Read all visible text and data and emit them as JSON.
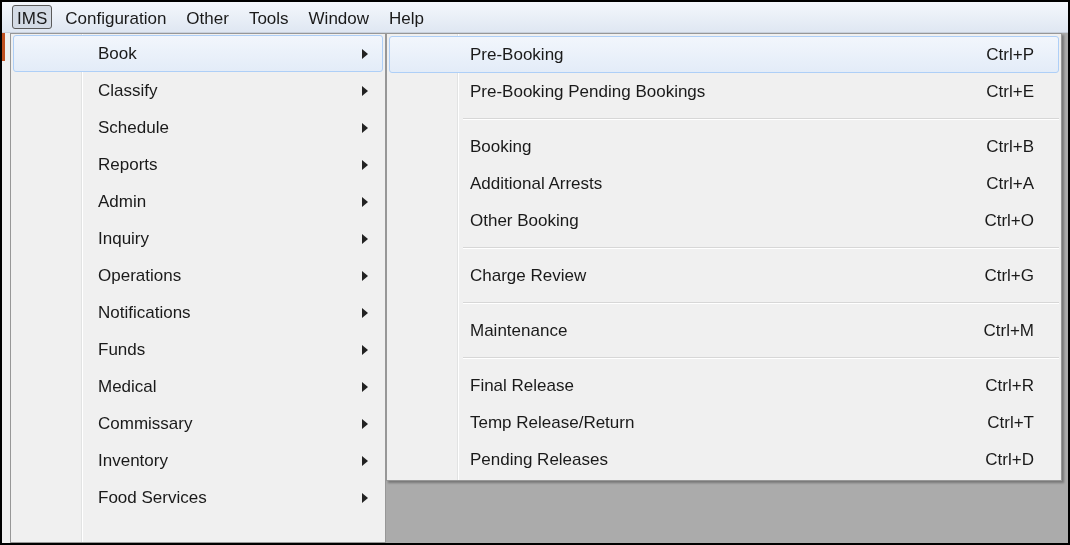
{
  "menubar": [
    {
      "label": "IMS",
      "selected": true
    },
    {
      "label": "Configuration",
      "selected": false
    },
    {
      "label": "Other",
      "selected": false
    },
    {
      "label": "Tools",
      "selected": false
    },
    {
      "label": "Window",
      "selected": false
    },
    {
      "label": "Help",
      "selected": false
    }
  ],
  "menu": [
    {
      "label": "Book",
      "selected": true
    },
    {
      "label": "Classify",
      "selected": false
    },
    {
      "label": "Schedule",
      "selected": false
    },
    {
      "label": "Reports",
      "selected": false
    },
    {
      "label": "Admin",
      "selected": false
    },
    {
      "label": "Inquiry",
      "selected": false
    },
    {
      "label": "Operations",
      "selected": false
    },
    {
      "label": "Notifications",
      "selected": false
    },
    {
      "label": "Funds",
      "selected": false
    },
    {
      "label": "Medical",
      "selected": false
    },
    {
      "label": "Commissary",
      "selected": false
    },
    {
      "label": "Inventory",
      "selected": false
    },
    {
      "label": "Food Services",
      "selected": false
    }
  ],
  "submenu": [
    [
      {
        "label": "Pre-Booking",
        "shortcut": "Ctrl+P",
        "selected": true
      },
      {
        "label": "Pre-Booking Pending Bookings",
        "shortcut": "Ctrl+E",
        "selected": false
      }
    ],
    [
      {
        "label": "Booking",
        "shortcut": "Ctrl+B",
        "selected": false
      },
      {
        "label": "Additional Arrests",
        "shortcut": "Ctrl+A",
        "selected": false
      },
      {
        "label": "Other Booking",
        "shortcut": "Ctrl+O",
        "selected": false
      }
    ],
    [
      {
        "label": "Charge Review",
        "shortcut": "Ctrl+G",
        "selected": false
      }
    ],
    [
      {
        "label": "Maintenance",
        "shortcut": "Ctrl+M",
        "selected": false
      }
    ],
    [
      {
        "label": "Final Release",
        "shortcut": "Ctrl+R",
        "selected": false
      },
      {
        "label": "Temp Release/Return",
        "shortcut": "Ctrl+T",
        "selected": false
      },
      {
        "label": "Pending Releases",
        "shortcut": "Ctrl+D",
        "selected": false
      }
    ]
  ]
}
